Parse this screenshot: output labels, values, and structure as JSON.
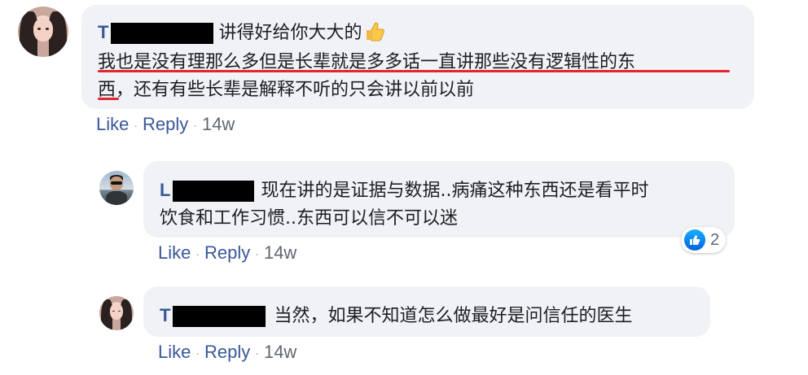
{
  "comments": [
    {
      "author": "T",
      "header_text": "讲得好给你大大的",
      "emoji": "thumbs-up-emoji",
      "lines": [
        "我也是没有理那么多但是长辈就是多多话一直讲那些没有逻辑性的东",
        "西，还有有些长辈是解释不听的只会讲以前以前"
      ],
      "actions": {
        "like": "Like",
        "reply": "Reply",
        "time": "14w"
      }
    },
    {
      "author": "L",
      "lines_first": "现在讲的是证据与数据..病痛这种东西还是看平时",
      "lines": [
        "饮食和工作习惯..东西可以信不可以迷"
      ],
      "reaction_count": "2",
      "actions": {
        "like": "Like",
        "reply": "Reply",
        "time": "14w"
      }
    },
    {
      "author": "T",
      "lines_first": "当然，如果不知道怎么做最好是问信任的医生",
      "actions": {
        "like": "Like",
        "reply": "Reply",
        "time": "14w"
      }
    }
  ],
  "colors": {
    "link": "#385898",
    "bubble": "#f0f2f5",
    "underline": "#e3262e",
    "like_blue": "#1877f2"
  }
}
